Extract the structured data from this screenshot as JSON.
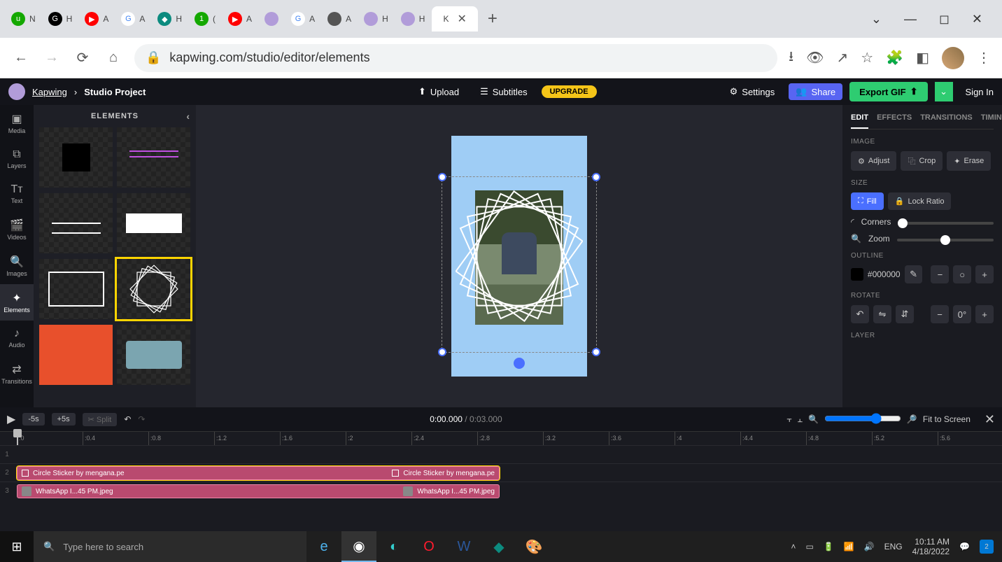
{
  "browser": {
    "tabs": [
      {
        "fav_bg": "#14a800",
        "fav_txt": "u",
        "label": "N"
      },
      {
        "fav_bg": "#000",
        "fav_txt": "G",
        "label": "H"
      },
      {
        "fav_bg": "#ff0000",
        "fav_txt": "▶",
        "label": "A"
      },
      {
        "fav_bg": "#fff",
        "fav_txt": "G",
        "label": "A",
        "fav_color": "#4285f4"
      },
      {
        "fav_bg": "#0c8b7f",
        "fav_txt": "◆",
        "label": "H"
      },
      {
        "fav_bg": "#14a800",
        "fav_txt": "1",
        "label": "("
      },
      {
        "fav_bg": "#ff0000",
        "fav_txt": "▶",
        "label": "A"
      },
      {
        "fav_bg": "#b19cd9",
        "fav_txt": "",
        "label": ""
      },
      {
        "fav_bg": "#fff",
        "fav_txt": "G",
        "label": "A",
        "fav_color": "#4285f4"
      },
      {
        "fav_bg": "#555",
        "fav_txt": "",
        "label": "A"
      },
      {
        "fav_bg": "#b19cd9",
        "fav_txt": "",
        "label": "H"
      },
      {
        "fav_bg": "#b19cd9",
        "fav_txt": "",
        "label": "H"
      }
    ],
    "active_tab": {
      "label": "K"
    },
    "url": "kapwing.com/studio/editor/elements"
  },
  "header": {
    "brand": "Kapwing",
    "project": "Studio Project",
    "upload": "Upload",
    "subtitles": "Subtitles",
    "upgrade": "UPGRADE",
    "settings": "Settings",
    "share": "Share",
    "export": "Export GIF",
    "signin": "Sign In"
  },
  "rail": [
    "Media",
    "Layers",
    "Text",
    "Videos",
    "Images",
    "Elements",
    "Audio",
    "Transitions"
  ],
  "rail_active": 5,
  "panel": {
    "title": "ELEMENTS"
  },
  "canvas": {},
  "props": {
    "tabs": [
      "EDIT",
      "EFFECTS",
      "TRANSITIONS",
      "TIMING"
    ],
    "image": "IMAGE",
    "adjust": "Adjust",
    "crop": "Crop",
    "erase": "Erase",
    "size": "SIZE",
    "fill": "Fill",
    "lock": "Lock Ratio",
    "corners": "Corners",
    "zoom": "Zoom",
    "outline": "OUTLINE",
    "outline_color": "#000000",
    "rotate": "ROTATE",
    "layer": "LAYER"
  },
  "timeline": {
    "minus": "-5s",
    "plus": "+5s",
    "split": "Split",
    "current": "0:00.000",
    "total": "0:03.000",
    "fit": "Fit to Screen",
    "ticks": [
      ":0",
      ":0.4",
      ":0.8",
      ":1.2",
      ":1.6",
      ":2",
      ":2.4",
      ":2.8",
      ":3.2",
      ":3.6",
      ":4",
      ":4.4",
      ":4.8",
      ":5.2",
      ":5.6"
    ],
    "track_nums": [
      "1",
      "2",
      "3"
    ],
    "clip_sticker": "Circle Sticker by mengana.pe",
    "clip_img": "WhatsApp I...45 PM.jpeg"
  },
  "taskbar": {
    "search_ph": "Type here to search",
    "lang": "ENG",
    "time": "10:11 AM",
    "date": "4/18/2022",
    "notif": "2"
  }
}
